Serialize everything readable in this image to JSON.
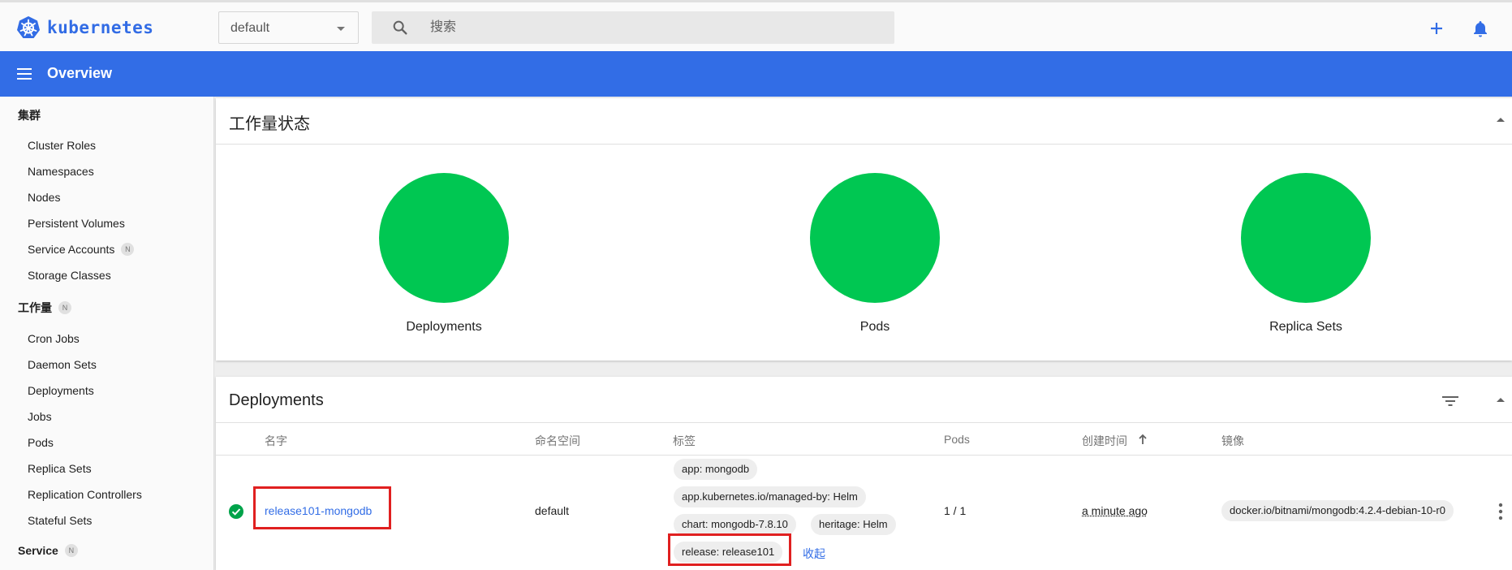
{
  "brand": {
    "name": "kubernetes",
    "color": "#326ce5"
  },
  "namespace_select": {
    "value": "default"
  },
  "search": {
    "placeholder": "搜索",
    "icon": "search-icon"
  },
  "topbar_actions": {
    "create_icon": "plus-icon",
    "notifications_icon": "bell-icon"
  },
  "header": {
    "title": "Overview",
    "menu_icon": "menu-icon",
    "color": "#326de6"
  },
  "sidebar": {
    "cluster": {
      "title": "集群",
      "items": [
        {
          "label": "Cluster Roles"
        },
        {
          "label": "Namespaces"
        },
        {
          "label": "Nodes"
        },
        {
          "label": "Persistent Volumes"
        },
        {
          "label": "Service Accounts",
          "badge": "N"
        },
        {
          "label": "Storage Classes"
        }
      ]
    },
    "workloads": {
      "title": "工作量",
      "badge": "N",
      "items": [
        {
          "label": "Cron Jobs"
        },
        {
          "label": "Daemon Sets"
        },
        {
          "label": "Deployments"
        },
        {
          "label": "Jobs"
        },
        {
          "label": "Pods"
        },
        {
          "label": "Replica Sets"
        },
        {
          "label": "Replication Controllers"
        },
        {
          "label": "Stateful Sets"
        }
      ]
    },
    "service": {
      "title": "Service",
      "badge": "N"
    }
  },
  "workload_status": {
    "title": "工作量状态",
    "status_color": "#00c752",
    "items": [
      {
        "label": "Deployments"
      },
      {
        "label": "Pods"
      },
      {
        "label": "Replica Sets"
      }
    ]
  },
  "deployments": {
    "title": "Deployments",
    "filter_icon": "filter-icon",
    "columns": {
      "name": "名字",
      "namespace": "命名空间",
      "labels": "标签",
      "pods": "Pods",
      "created": "创建时间",
      "images": "镜像"
    },
    "sort_icon": "arrow-up-icon",
    "rows": [
      {
        "status_icon": "check-circle-icon",
        "name": "release101-mongodb",
        "namespace": "default",
        "labels": [
          "app: mongodb",
          "app.kubernetes.io/managed-by: Helm",
          "chart: mongodb-7.8.10",
          "heritage: Helm",
          "release: release101"
        ],
        "collapse_label": "收起",
        "pods": "1 / 1",
        "created": "a minute ago",
        "image": "docker.io/bitnami/mongodb:4.2.4-debian-10-r0",
        "menu_icon": "more-vert-icon"
      }
    ]
  }
}
